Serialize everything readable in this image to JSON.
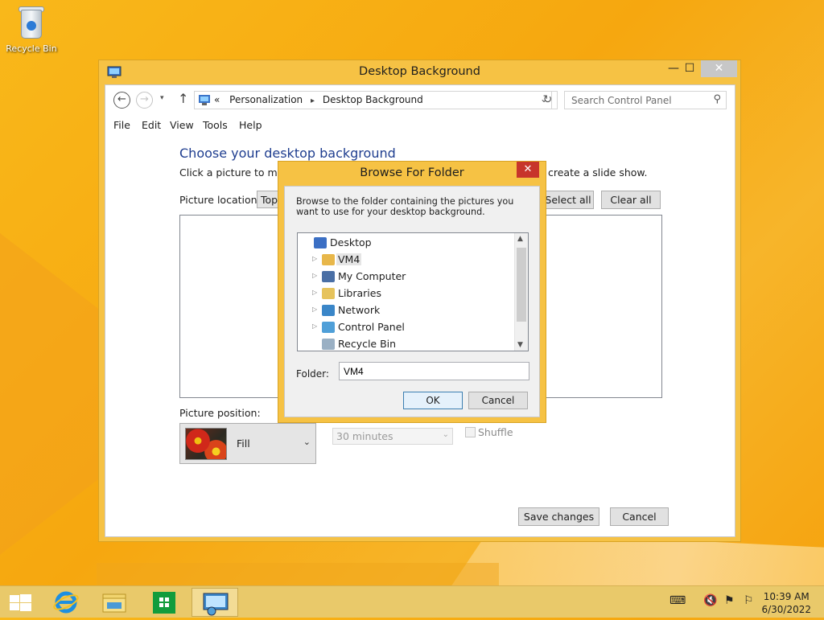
{
  "desktop": {
    "recycle_bin_label": "Recycle Bin"
  },
  "window": {
    "title": "Desktop Background",
    "controls": {
      "minimize": "—",
      "maximize": "☐",
      "close": "✕"
    },
    "nav": {
      "back": "←",
      "forward": "→",
      "recent": "▾",
      "up": "↑",
      "address_prefix": "«",
      "breadcrumb": [
        "Personalization",
        "Desktop Background"
      ],
      "breadcrumb_sep": "▸",
      "address_dropdown": "⌄",
      "refresh": "↻",
      "search_placeholder": "Search Control Panel",
      "search_icon": "⚲"
    },
    "menu": [
      "File",
      "Edit",
      "View",
      "Tools",
      "Help"
    ],
    "content": {
      "heading": "Choose your desktop background",
      "desc_left": "Click a picture to make",
      "desc_right": "create a slide show.",
      "picture_location_label": "Picture location:",
      "picture_location_value": "Top",
      "select_all": "Select all",
      "clear_all": "Clear all",
      "picture_position_label": "Picture position:",
      "picture_position_value": "Fill",
      "dropdown_arrow": "⌄",
      "interval_value": "30 minutes",
      "shuffle_label": "Shuffle"
    },
    "save_changes": "Save changes",
    "cancel": "Cancel"
  },
  "dialog": {
    "title": "Browse For Folder",
    "close": "✕",
    "message": "Browse to the folder containing the pictures you want to use for your desktop background.",
    "tree": [
      {
        "label": "Desktop",
        "icon": "desktop-icon",
        "color": "#3b6fc4",
        "expandable": false,
        "indent": 0
      },
      {
        "label": "VM4",
        "icon": "user-folder-icon",
        "color": "#e8b74a",
        "expandable": true,
        "indent": 1,
        "selected": true
      },
      {
        "label": "My Computer",
        "icon": "computer-icon",
        "color": "#4a6fa5",
        "expandable": true,
        "indent": 1
      },
      {
        "label": "Libraries",
        "icon": "libraries-icon",
        "color": "#e6c35c",
        "expandable": true,
        "indent": 1
      },
      {
        "label": "Network",
        "icon": "network-icon",
        "color": "#3a86c8",
        "expandable": true,
        "indent": 1
      },
      {
        "label": "Control Panel",
        "icon": "control-panel-icon",
        "color": "#4f9fd8",
        "expandable": true,
        "indent": 1
      },
      {
        "label": "Recycle Bin",
        "icon": "recycle-bin-icon",
        "color": "#9ab0c4",
        "expandable": false,
        "indent": 1
      }
    ],
    "expand_arrow": "▷",
    "scroll_up": "▲",
    "scroll_down": "▼",
    "folder_label": "Folder:",
    "folder_value": "VM4",
    "ok": "OK",
    "cancel": "Cancel"
  },
  "taskbar": {
    "clock_time": "10:39 AM",
    "clock_date": "6/30/2022",
    "tray_keyboard": "⌨",
    "tray_volume": "🔇",
    "tray_network": "⚑",
    "tray_flag": "⚐"
  },
  "colors": {
    "accent": "#f6c244",
    "heading": "#1e3d8f",
    "desktop": "#f7b01a"
  }
}
